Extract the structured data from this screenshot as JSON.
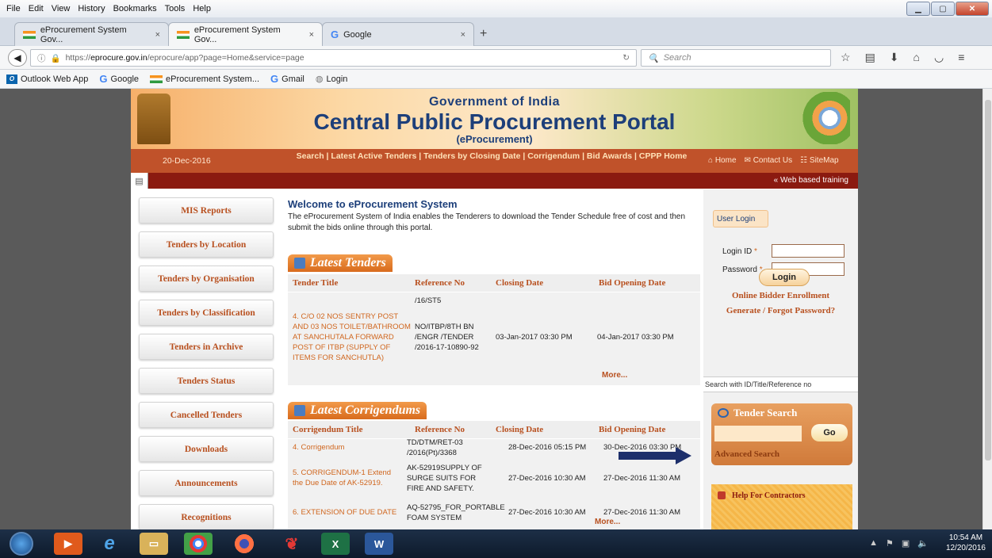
{
  "browser": {
    "menu": [
      "File",
      "Edit",
      "View",
      "History",
      "Bookmarks",
      "Tools",
      "Help"
    ],
    "tabs": [
      {
        "label": "eProcurement System Gov...",
        "close": "×"
      },
      {
        "label": "eProcurement System Gov...",
        "close": "×"
      },
      {
        "label": "Google",
        "close": "×"
      }
    ],
    "new_tab": "+",
    "url_prefix": "https://",
    "url_domain": "eprocure.gov.in",
    "url_rest": "/eprocure/app?page=Home&service=page",
    "search_placeholder": "Search",
    "bookmarks": [
      "Outlook Web App",
      "Google",
      "eProcurement System...",
      "Gmail",
      "Login"
    ]
  },
  "site": {
    "gov": "Government of India",
    "title": "Central Public Procurement Portal",
    "subtitle": "(eProcurement)",
    "date": "20-Dec-2016",
    "nav_links": "Search | Latest Active Tenders | Tenders by Closing Date | Corrigendum | Bid Awards | CPPP Home",
    "right_links": [
      "Home",
      "Contact Us",
      "SiteMap"
    ],
    "web_training": "« Web based training"
  },
  "left_nav": [
    "MIS Reports",
    "Tenders by Location",
    "Tenders by Organisation",
    "Tenders by Classification",
    "Tenders in Archive",
    "Tenders Status",
    "Cancelled Tenders",
    "Downloads",
    "Announcements",
    "Recognitions"
  ],
  "welcome": {
    "title": "Welcome to eProcurement System",
    "text": "The eProcurement System of India enables the Tenderers to download the Tender Schedule free of cost and then submit the bids online through this portal."
  },
  "latest_tenders": {
    "heading": "Latest Tenders",
    "columns": [
      "Tender Title",
      "Reference No",
      "Closing Date",
      "Bid Opening Date"
    ],
    "partial_ref": "/16/ST5",
    "rows": [
      {
        "title": "4. C/O 02 NOS SENTRY POST AND 03 NOS TOILET/BATHROOM AT SANCHUTALA FORWARD POST OF ITBP (SUPPLY OF ITEMS FOR SANCHUTLA)",
        "ref": "NO/ITBP/8TH BN /ENGR /TENDER /2016-17-10890-92",
        "closing": "03-Jan-2017 03:30 PM",
        "opening": "04-Jan-2017 03:30 PM"
      }
    ],
    "more": "More..."
  },
  "latest_corrigendums": {
    "heading": "Latest Corrigendums",
    "columns": [
      "Corrigendum Title",
      "Reference No",
      "Closing Date",
      "Bid Opening Date"
    ],
    "rows": [
      {
        "title": "4. Corrigendum",
        "ref": "TD/DTM/RET-03 /2016(Pt)/3368",
        "closing": "28-Dec-2016 05:15 PM",
        "opening": "30-Dec-2016 03:30 PM"
      },
      {
        "title": "5. CORRIGENDUM-1 Extend the Due Date of AK-52919.",
        "ref": "AK-52919SUPPLY OF SURGE SUITS FOR FIRE AND SAFETY.",
        "closing": "27-Dec-2016 10:30 AM",
        "opening": "27-Dec-2016 11:30 AM"
      },
      {
        "title": "6. EXTENSION OF DUE DATE",
        "ref": "AQ-52795_FOR_PORTABLE FOAM SYSTEM",
        "closing": "27-Dec-2016 10:30 AM",
        "opening": "27-Dec-2016 11:30 AM"
      }
    ],
    "more": "More..."
  },
  "login": {
    "heading": "User Login",
    "id_label": "Login ID",
    "password_label": "Password",
    "required": "*",
    "button": "Login",
    "enroll": "Online Bidder Enrollment",
    "forgot": "Generate / Forgot Password?"
  },
  "tender_search": {
    "hint": "Search with ID/Title/Reference no",
    "heading": "Tender Search",
    "go": "Go",
    "advanced": "Advanced Search"
  },
  "help": "Help For Contractors",
  "taskbar": {
    "time": "10:54 AM",
    "date": "12/20/2016"
  },
  "colors": {
    "accent": "#c0522a",
    "dark_red": "#8b1a10",
    "link": "#b8501f",
    "navy": "#1d3f7a"
  }
}
